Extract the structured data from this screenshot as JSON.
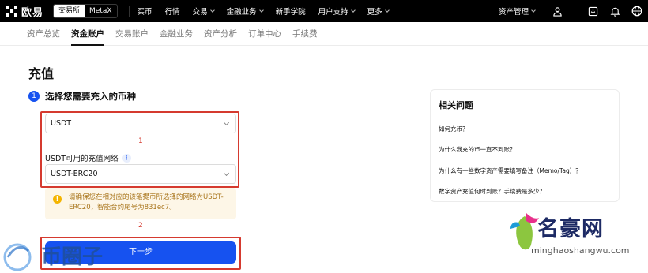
{
  "colors": {
    "nav_bg": "#000000",
    "accent_blue": "#1652f0",
    "annotation_red": "#d53a2f",
    "warning_bg": "#fdf6e7",
    "warning_text": "#a8741a"
  },
  "topnav": {
    "logo_text": "欧易",
    "switch": {
      "exchange": "交易所",
      "wallet": "MetaX"
    },
    "links": [
      {
        "label": "买币",
        "dropdown": false
      },
      {
        "label": "行情",
        "dropdown": false
      },
      {
        "label": "交易",
        "dropdown": true
      },
      {
        "label": "金融业务",
        "dropdown": true
      },
      {
        "label": "新手学院",
        "dropdown": false
      },
      {
        "label": "用户支持",
        "dropdown": true
      },
      {
        "label": "更多",
        "dropdown": true
      }
    ],
    "asset_management": "资产管理",
    "icons": [
      "user-icon",
      "download-icon",
      "bell-icon",
      "globe-icon"
    ]
  },
  "subnav": {
    "tabs": [
      {
        "label": "资产总览",
        "active": false
      },
      {
        "label": "资金账户",
        "active": true
      },
      {
        "label": "交易账户",
        "active": false
      },
      {
        "label": "金融业务",
        "active": false
      },
      {
        "label": "资产分析",
        "active": false
      },
      {
        "label": "订单中心",
        "active": false
      },
      {
        "label": "手续费",
        "active": false
      }
    ]
  },
  "main": {
    "title": "充值",
    "step_number": "1",
    "step_text": "选择您需要充入的币种",
    "coin_select": {
      "value": "USDT"
    },
    "network_label": "USDT可用的充值网络",
    "network_info_icon": "i",
    "network_select": {
      "value": "USDT-ERC20"
    },
    "warning_icon": "!",
    "warning_text": "请确保您在相对应的该笔提币所选择的网络为USDT-ERC20，智能合约尾号为831ec7。",
    "next_button": "下一步",
    "annotations": {
      "box1": "1",
      "box2": "2"
    }
  },
  "faq": {
    "title": "相关问题",
    "items": [
      "如何充币？",
      "为什么我充的币一直不到账？",
      "为什么有一些数字资产需要填写备注（Memo/Tag）？",
      "数字资产充值何时到账？手续费是多少？"
    ]
  },
  "watermarks": {
    "left_text": "币圈子",
    "right_brand": "名豪网",
    "right_url": "minghaoshangwu.com"
  }
}
